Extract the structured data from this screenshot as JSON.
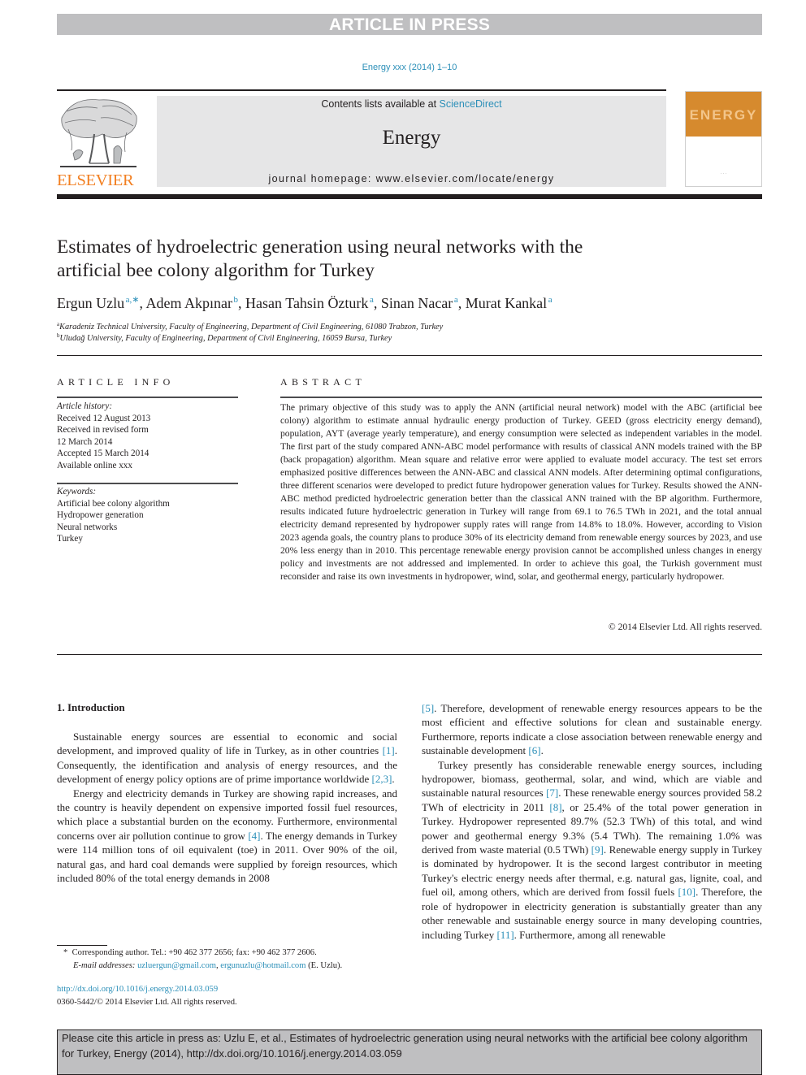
{
  "banner": {
    "text": "ARTICLE IN PRESS"
  },
  "journal_ref": "Energy xxx (2014) 1–10",
  "masthead": {
    "contents_prefix": "Contents lists available at ",
    "contents_link": "ScienceDirect",
    "journal_name": "Energy",
    "homepage": "journal homepage: www.elsevier.com/locate/energy"
  },
  "publisher": {
    "logo_word": "ELSEVIER"
  },
  "cover": {
    "word": "ENERGY"
  },
  "colors": {
    "link": "#2b8fb8",
    "banner": "#bfbfc1",
    "elsevier_orange": "#f27f21",
    "cover_orange": "#d68a2e",
    "masthead_bg": "#e6e6e7"
  },
  "article": {
    "title_line1": "Estimates of hydroelectric generation using neural networks with the",
    "title_line2": "artificial bee colony algorithm for Turkey",
    "authors": [
      {
        "name": "Ergun Uzlu",
        "sup": "a,∗",
        "sep": ", "
      },
      {
        "name": "Adem Akpınar",
        "sup": "b",
        "sep": ", "
      },
      {
        "name": "Hasan Tahsin Özturk",
        "sup": "a",
        "sep": ", "
      },
      {
        "name": "Sinan Nacar",
        "sup": "a",
        "sep": ", "
      },
      {
        "name": "Murat Kankal",
        "sup": "a",
        "sep": ""
      }
    ],
    "affiliations": [
      {
        "sup": "a",
        "text": "Karadeniz Technical University, Faculty of Engineering, Department of Civil Engineering, 61080 Trabzon, Turkey"
      },
      {
        "sup": "b",
        "text": "Uludağ University, Faculty of Engineering, Department of Civil Engineering, 16059 Bursa, Turkey"
      }
    ]
  },
  "article_info": {
    "heading": "ARTICLE INFO",
    "history_label": "Article history:",
    "history": [
      "Received 12 August 2013",
      "Received in revised form",
      "12 March 2014",
      "Accepted 15 March 2014",
      "Available online xxx"
    ],
    "keywords_label": "Keywords:",
    "keywords": [
      "Artificial bee colony algorithm",
      "Hydropower generation",
      "Neural networks",
      "Turkey"
    ]
  },
  "abstract": {
    "heading": "ABSTRACT",
    "text": "The primary objective of this study was to apply the ANN (artificial neural network) model with the ABC (artificial bee colony) algorithm to estimate annual hydraulic energy production of Turkey. GEED (gross electricity energy demand), population, AYT (average yearly temperature), and energy consumption were selected as independent variables in the model. The first part of the study compared ANN-ABC model performance with results of classical ANN models trained with the BP (back propagation) algorithm. Mean square and relative error were applied to evaluate model accuracy. The test set errors emphasized positive differences between the ANN-ABC and classical ANN models. After determining optimal configurations, three different scenarios were developed to predict future hydropower generation values for Turkey. Results showed the ANN-ABC method predicted hydroelectric generation better than the classical ANN trained with the BP algorithm. Furthermore, results indicated future hydroelectric generation in Turkey will range from 69.1 to 76.5 TWh in 2021, and the total annual electricity demand represented by hydropower supply rates will range from 14.8% to 18.0%. However, according to Vision 2023 agenda goals, the country plans to produce 30% of its electricity demand from renewable energy sources by 2023, and use 20% less energy than in 2010. This percentage renewable energy provision cannot be accomplished unless changes in energy policy and investments are not addressed and implemented. In order to achieve this goal, the Turkish government must reconsider and raise its own investments in hydropower, wind, solar, and geothermal energy, particularly hydropower.",
    "copyright": "© 2014 Elsevier Ltd. All rights reserved."
  },
  "introduction": {
    "heading": "1.  Introduction",
    "left_paragraphs": [
      [
        {
          "t": "Sustainable energy sources are essential to economic and social development, and improved quality of life in Turkey, as in other countries "
        },
        {
          "r": "[1]"
        },
        {
          "t": ". Consequently, the identification and analysis of energy resources, and the development of energy policy options are of prime importance worldwide "
        },
        {
          "r": "[2,3]"
        },
        {
          "t": "."
        }
      ],
      [
        {
          "t": "Energy and electricity demands in Turkey are showing rapid increases, and the country is heavily dependent on expensive imported fossil fuel resources, which place a substantial burden on the economy. Furthermore, environmental concerns over air pollution continue to grow "
        },
        {
          "r": "[4]"
        },
        {
          "t": ". The energy demands in Turkey were 114 million tons of oil equivalent (toe) in 2011. Over 90% of the oil, natural gas, and hard coal demands were supplied by foreign resources, which included 80% of the total energy demands in 2008"
        }
      ]
    ],
    "right_paragraphs": [
      [
        {
          "r": "[5]"
        },
        {
          "t": ". Therefore, development of renewable energy resources appears to be the most efficient and effective solutions for clean and sustainable energy. Furthermore, reports indicate a close association between renewable energy and sustainable development "
        },
        {
          "r": "[6]"
        },
        {
          "t": "."
        }
      ],
      [
        {
          "t": "Turkey presently has considerable renewable energy sources, including hydropower, biomass, geothermal, solar, and wind, which are viable and sustainable natural resources "
        },
        {
          "r": "[7]"
        },
        {
          "t": ". These renewable energy sources provided 58.2 TWh of electricity in 2011 "
        },
        {
          "r": "[8]"
        },
        {
          "t": ", or 25.4% of the total power generation in Turkey. Hydropower represented 89.7% (52.3 TWh) of this total, and wind power and geothermal energy 9.3% (5.4 TWh). The remaining 1.0% was derived from waste material (0.5 TWh) "
        },
        {
          "r": "[9]"
        },
        {
          "t": ". Renewable energy supply in Turkey is dominated by hydropower. It is the second largest contributor in meeting Turkey's electric energy needs after thermal, e.g. natural gas, lignite, coal, and fuel oil, among others, which are derived from fossil fuels "
        },
        {
          "r": "[10]"
        },
        {
          "t": ". Therefore, the role of hydropower in electricity generation is substantially greater than any other renewable and sustainable energy source in many developing countries, including Turkey "
        },
        {
          "r": "[11]"
        },
        {
          "t": ". Furthermore, among all renewable"
        }
      ]
    ]
  },
  "footnote": {
    "star": "*",
    "corresponding": "Corresponding author. Tel.: +90 462 377 2656; fax: +90 462 377 2606.",
    "email_label": "E-mail addresses:",
    "email1": "uzluergun@gmail.com",
    "email_sep": ", ",
    "email2": "ergunuzlu@hotmail.com",
    "email_suffix": " (E. Uzlu)."
  },
  "doi": {
    "link": "http://dx.doi.org/10.1016/j.energy.2014.03.059",
    "issn_line": "0360-5442/© 2014 Elsevier Ltd. All rights reserved."
  },
  "citation_box": {
    "text": "Please cite this article in press as: Uzlu E, et al., Estimates of hydroelectric generation using neural networks with the artificial bee colony algorithm for Turkey, Energy (2014), http://dx.doi.org/10.1016/j.energy.2014.03.059"
  }
}
